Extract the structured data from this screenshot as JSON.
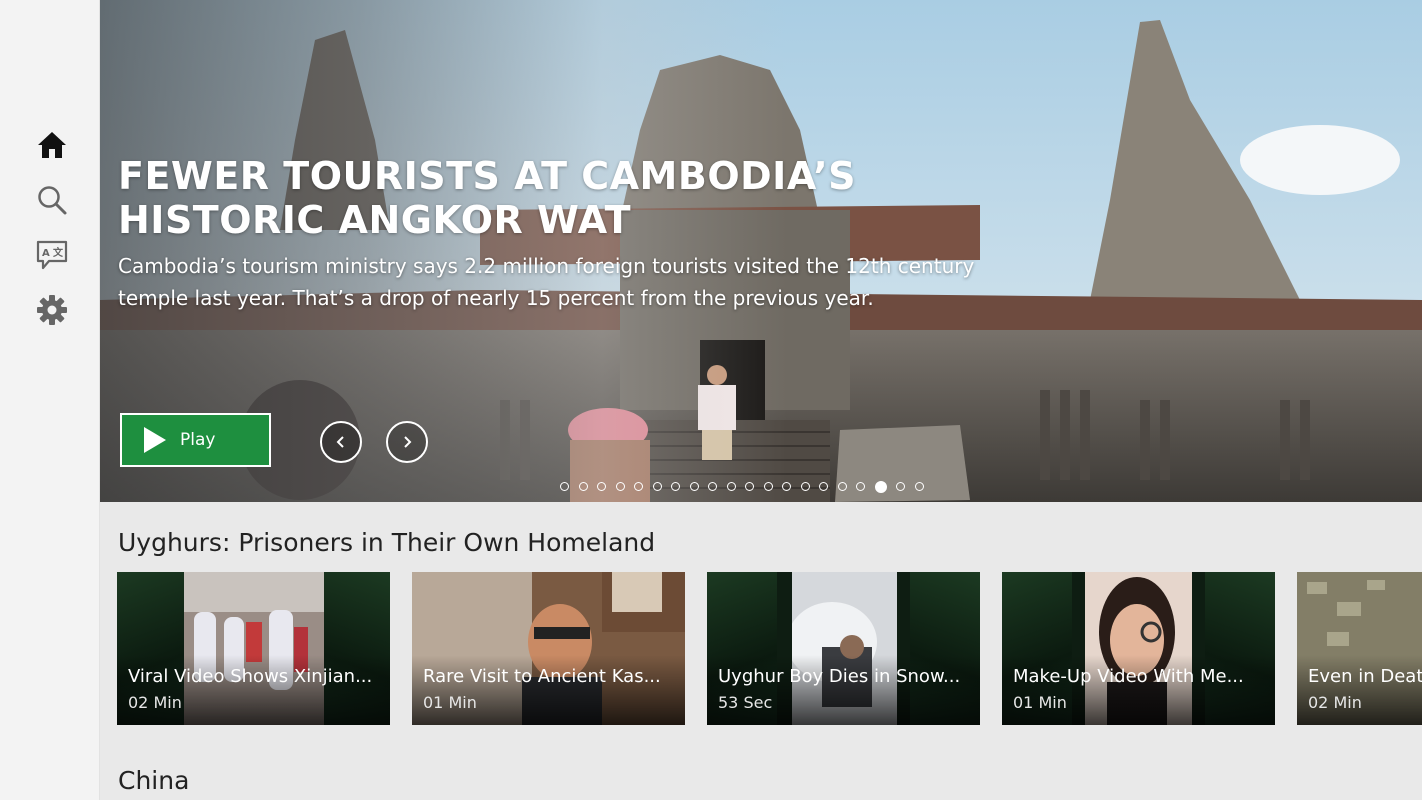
{
  "sidebar": {
    "items": [
      {
        "icon": "home-icon",
        "active": true
      },
      {
        "icon": "search-icon"
      },
      {
        "icon": "translate-icon"
      },
      {
        "icon": "gear-icon"
      }
    ]
  },
  "hero": {
    "title": "FEWER TOURISTS AT CAMBODIA’S HISTORIC ANGKOR WAT",
    "description": "Cambodia’s tourism ministry says 2.2 million foreign tourists visited the 12th century temple last year. That’s a drop of nearly 15 percent from the previous year.",
    "play_label": "Play",
    "dot_count": 20,
    "active_dot": 17,
    "colors": {
      "play_button": "#1e8f3f"
    }
  },
  "sections": [
    {
      "title": "Uyghurs: Prisoners in Their Own Homeland",
      "cards": [
        {
          "title": "Viral Video Shows Xinjian...",
          "duration": "02 Min"
        },
        {
          "title": "Rare Visit to Ancient Kas...",
          "duration": "01 Min"
        },
        {
          "title": "Uyghur Boy Dies in Snow...",
          "duration": "53 Sec"
        },
        {
          "title": "Make-Up Video With Me...",
          "duration": "01 Min"
        },
        {
          "title": "Even in Death",
          "duration": "02 Min"
        }
      ]
    },
    {
      "title": "China"
    }
  ]
}
